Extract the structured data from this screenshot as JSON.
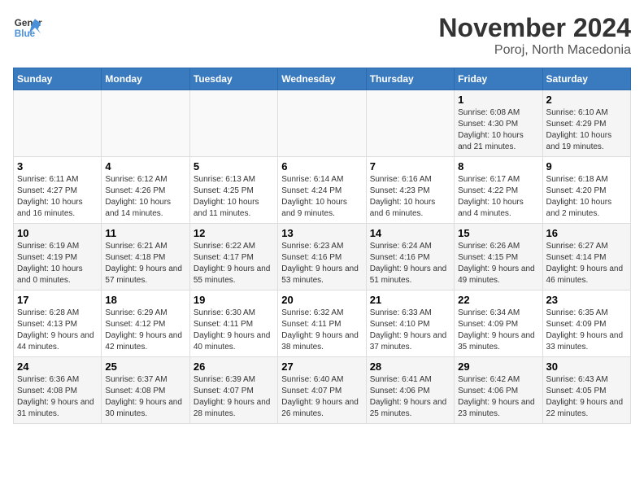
{
  "header": {
    "logo_general": "General",
    "logo_blue": "Blue",
    "month_year": "November 2024",
    "location": "Poroj, North Macedonia"
  },
  "days_of_week": [
    "Sunday",
    "Monday",
    "Tuesday",
    "Wednesday",
    "Thursday",
    "Friday",
    "Saturday"
  ],
  "weeks": [
    [
      {
        "day": "",
        "info": ""
      },
      {
        "day": "",
        "info": ""
      },
      {
        "day": "",
        "info": ""
      },
      {
        "day": "",
        "info": ""
      },
      {
        "day": "",
        "info": ""
      },
      {
        "day": "1",
        "info": "Sunrise: 6:08 AM\nSunset: 4:30 PM\nDaylight: 10 hours and 21 minutes."
      },
      {
        "day": "2",
        "info": "Sunrise: 6:10 AM\nSunset: 4:29 PM\nDaylight: 10 hours and 19 minutes."
      }
    ],
    [
      {
        "day": "3",
        "info": "Sunrise: 6:11 AM\nSunset: 4:27 PM\nDaylight: 10 hours and 16 minutes."
      },
      {
        "day": "4",
        "info": "Sunrise: 6:12 AM\nSunset: 4:26 PM\nDaylight: 10 hours and 14 minutes."
      },
      {
        "day": "5",
        "info": "Sunrise: 6:13 AM\nSunset: 4:25 PM\nDaylight: 10 hours and 11 minutes."
      },
      {
        "day": "6",
        "info": "Sunrise: 6:14 AM\nSunset: 4:24 PM\nDaylight: 10 hours and 9 minutes."
      },
      {
        "day": "7",
        "info": "Sunrise: 6:16 AM\nSunset: 4:23 PM\nDaylight: 10 hours and 6 minutes."
      },
      {
        "day": "8",
        "info": "Sunrise: 6:17 AM\nSunset: 4:22 PM\nDaylight: 10 hours and 4 minutes."
      },
      {
        "day": "9",
        "info": "Sunrise: 6:18 AM\nSunset: 4:20 PM\nDaylight: 10 hours and 2 minutes."
      }
    ],
    [
      {
        "day": "10",
        "info": "Sunrise: 6:19 AM\nSunset: 4:19 PM\nDaylight: 10 hours and 0 minutes."
      },
      {
        "day": "11",
        "info": "Sunrise: 6:21 AM\nSunset: 4:18 PM\nDaylight: 9 hours and 57 minutes."
      },
      {
        "day": "12",
        "info": "Sunrise: 6:22 AM\nSunset: 4:17 PM\nDaylight: 9 hours and 55 minutes."
      },
      {
        "day": "13",
        "info": "Sunrise: 6:23 AM\nSunset: 4:16 PM\nDaylight: 9 hours and 53 minutes."
      },
      {
        "day": "14",
        "info": "Sunrise: 6:24 AM\nSunset: 4:16 PM\nDaylight: 9 hours and 51 minutes."
      },
      {
        "day": "15",
        "info": "Sunrise: 6:26 AM\nSunset: 4:15 PM\nDaylight: 9 hours and 49 minutes."
      },
      {
        "day": "16",
        "info": "Sunrise: 6:27 AM\nSunset: 4:14 PM\nDaylight: 9 hours and 46 minutes."
      }
    ],
    [
      {
        "day": "17",
        "info": "Sunrise: 6:28 AM\nSunset: 4:13 PM\nDaylight: 9 hours and 44 minutes."
      },
      {
        "day": "18",
        "info": "Sunrise: 6:29 AM\nSunset: 4:12 PM\nDaylight: 9 hours and 42 minutes."
      },
      {
        "day": "19",
        "info": "Sunrise: 6:30 AM\nSunset: 4:11 PM\nDaylight: 9 hours and 40 minutes."
      },
      {
        "day": "20",
        "info": "Sunrise: 6:32 AM\nSunset: 4:11 PM\nDaylight: 9 hours and 38 minutes."
      },
      {
        "day": "21",
        "info": "Sunrise: 6:33 AM\nSunset: 4:10 PM\nDaylight: 9 hours and 37 minutes."
      },
      {
        "day": "22",
        "info": "Sunrise: 6:34 AM\nSunset: 4:09 PM\nDaylight: 9 hours and 35 minutes."
      },
      {
        "day": "23",
        "info": "Sunrise: 6:35 AM\nSunset: 4:09 PM\nDaylight: 9 hours and 33 minutes."
      }
    ],
    [
      {
        "day": "24",
        "info": "Sunrise: 6:36 AM\nSunset: 4:08 PM\nDaylight: 9 hours and 31 minutes."
      },
      {
        "day": "25",
        "info": "Sunrise: 6:37 AM\nSunset: 4:08 PM\nDaylight: 9 hours and 30 minutes."
      },
      {
        "day": "26",
        "info": "Sunrise: 6:39 AM\nSunset: 4:07 PM\nDaylight: 9 hours and 28 minutes."
      },
      {
        "day": "27",
        "info": "Sunrise: 6:40 AM\nSunset: 4:07 PM\nDaylight: 9 hours and 26 minutes."
      },
      {
        "day": "28",
        "info": "Sunrise: 6:41 AM\nSunset: 4:06 PM\nDaylight: 9 hours and 25 minutes."
      },
      {
        "day": "29",
        "info": "Sunrise: 6:42 AM\nSunset: 4:06 PM\nDaylight: 9 hours and 23 minutes."
      },
      {
        "day": "30",
        "info": "Sunrise: 6:43 AM\nSunset: 4:05 PM\nDaylight: 9 hours and 22 minutes."
      }
    ]
  ]
}
